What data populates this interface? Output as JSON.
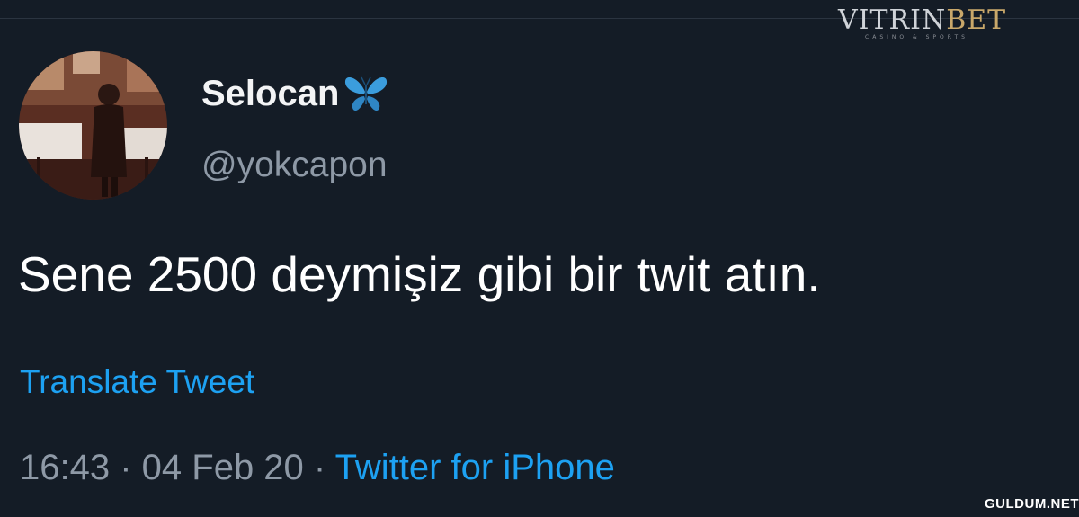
{
  "watermark": {
    "brand_part1": "VITRIN",
    "brand_part2": "BET",
    "tagline": "CASINO & SPORTS"
  },
  "tweet": {
    "display_name": "Selocan",
    "name_emoji": "butterfly-icon",
    "handle": "@yokcapon",
    "text": "Sene 2500 deymişiz gibi bir twit atın.",
    "translate_label": "Translate Tweet",
    "time": "16:43",
    "separator": " · ",
    "date": "04 Feb 20",
    "source": "Twitter for iPhone"
  },
  "site_watermark": "GULDUM.NET",
  "colors": {
    "background": "#141c26",
    "link": "#1da1f2",
    "secondary_text": "#8e99a6",
    "butterfly": "#3b9ddd"
  }
}
